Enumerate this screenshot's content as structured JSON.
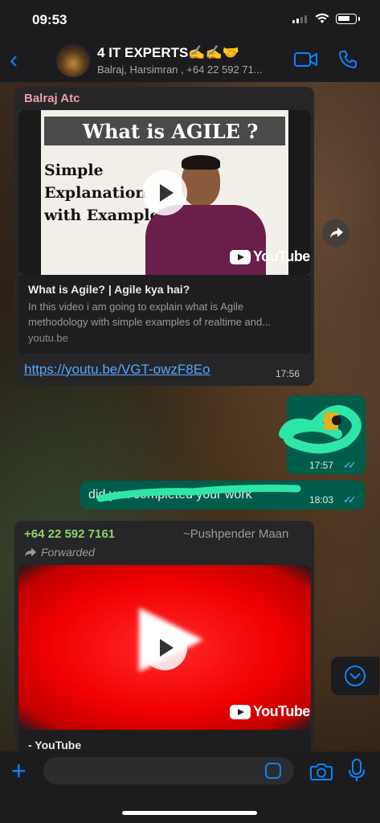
{
  "status_bar": {
    "time": "09:53"
  },
  "header": {
    "back_icon": "chevron-left",
    "title": "4 IT EXPERTS✍️✍️🤝",
    "members": "Balraj, Harsimran , +64 22 592 71...",
    "icons": [
      "video-camera-icon",
      "phone-icon"
    ]
  },
  "messages": {
    "m1": {
      "sender": "Balraj Atc",
      "thumb_text": {
        "heading": "What is AGILE ?",
        "line1": "Simple",
        "line2": "Explanation",
        "line3": "with Example"
      },
      "yt_label": "YouTube",
      "preview_title": "What is Agile? | Agile kya hai?",
      "preview_desc": "In this video i am going to explain what is Agile methodology with simple examples of realtime and...",
      "preview_domain": "youtu.be",
      "link": "https://youtu.be/VGT-owzF8Eo",
      "time": "17:56"
    },
    "m2": {
      "time": "17:57",
      "ticks": "✓✓"
    },
    "m3": {
      "text": "did you completed your work",
      "time": "18:03",
      "ticks": "✓✓"
    },
    "m4": {
      "sender_phone": "+64 22 592 7161",
      "sender_name": "~Pushpender Maan",
      "forwarded": "Forwarded",
      "yt_label": "YouTube",
      "preview_title": "- YouTube"
    }
  },
  "colors": {
    "accent": "#0a84ff",
    "outgoing": "#005c4b",
    "incoming": "#262628",
    "sender1": "#e8a0a8",
    "sender2": "#8bd36a",
    "link": "#53a7ff",
    "read_ticks": "#53bdeb"
  },
  "composer": {
    "placeholder": ""
  }
}
